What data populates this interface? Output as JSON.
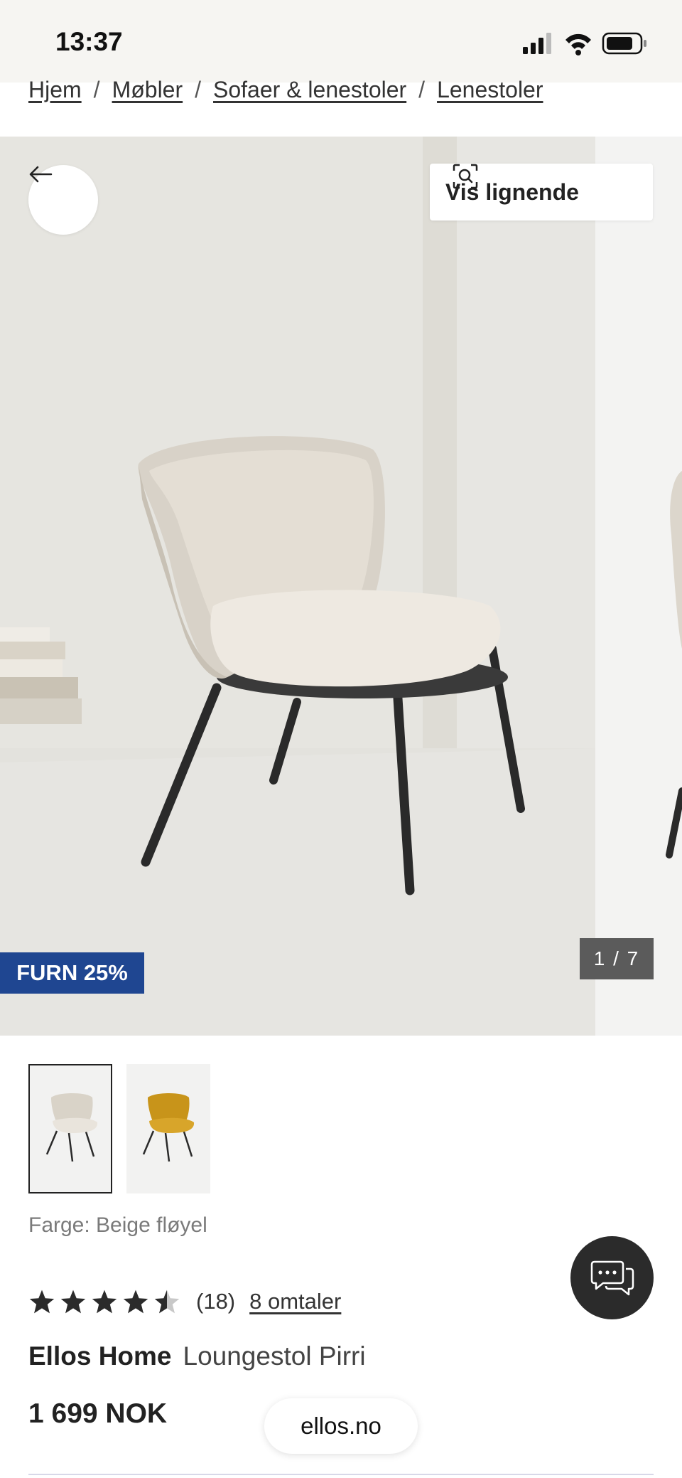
{
  "status_bar": {
    "time": "13:37",
    "signal_icon": "signal-icon",
    "wifi_icon": "wifi-icon",
    "battery_icon": "battery-icon"
  },
  "breadcrumb": {
    "items": [
      "Hjem",
      "Møbler",
      "Sofaer & lenestoler",
      "Lenestoler"
    ],
    "separator": "/"
  },
  "hero": {
    "back_icon": "arrow-left-icon",
    "similar_icon": "visual-search-icon",
    "similar_label": "Vis lignende",
    "badge": "FURN 25%",
    "counter": "1 / 7"
  },
  "thumbnails": [
    {
      "name": "beige",
      "active": true
    },
    {
      "name": "mustard",
      "active": false
    }
  ],
  "product": {
    "color_label": "Farge: Beige fløyel",
    "rating": 4.5,
    "rating_count": "(18)",
    "reviews_link": "8 omtaler",
    "brand": "Ellos Home",
    "name": "Loungestol Pirri",
    "price": "1 699 NOK"
  },
  "chat": {
    "icon": "chat-bubbles-icon"
  },
  "browser": {
    "url": "ellos.no"
  },
  "colors": {
    "badge": "#1f4691",
    "counter_bg": "#5b5b5b",
    "chat_bg": "#2b2b2b",
    "status_bg": "#f6f5f2"
  }
}
